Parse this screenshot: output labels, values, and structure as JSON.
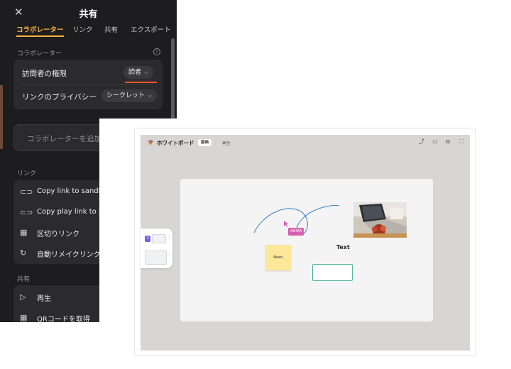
{
  "share_panel": {
    "close_glyph": "✕",
    "title": "共有",
    "tabs": [
      "コラボレーター",
      "リンク",
      "共有",
      "エクスポート"
    ],
    "active_tab": 0,
    "collaborators_heading": "コラボレーター",
    "help_glyph": "?",
    "visitor_permission_label": "訪問者の権限",
    "visitor_permission_value": "読者",
    "link_privacy_label": "リンクのプライバシー",
    "link_privacy_value": "シークレット",
    "add_collaborator_placeholder": "コラボレーターを追加",
    "link_heading": "リンク",
    "link_items": [
      {
        "icon": "link-icon",
        "glyph": "⊂⊃",
        "label": "Copy link to sandbo"
      },
      {
        "icon": "link-icon",
        "glyph": "⊂⊃",
        "label": "Copy play link to sa"
      },
      {
        "icon": "grid-icon",
        "glyph": "▦",
        "label": "区切りリンク"
      },
      {
        "icon": "refresh-icon",
        "glyph": "↻",
        "label": "自動リメイクリンク"
      }
    ],
    "share_heading": "共有",
    "share_items": [
      {
        "icon": "play-icon",
        "glyph": "▷",
        "label": "再生"
      },
      {
        "icon": "qr-icon",
        "glyph": "▦",
        "label": "QRコードを取得"
      }
    ],
    "accent_color": "#ffb23f",
    "underline_color": "#e9582a"
  },
  "whiteboard": {
    "title": "ホワイトボード",
    "badge": "篇画",
    "play_label": "再生",
    "toolbar_icons": [
      "share-icon",
      "crop-icon",
      "open-external-icon",
      "fullscreen-icon"
    ],
    "sticky_note_text": "News",
    "text_label": "Text",
    "cursor_user": "AKIRA",
    "pages": [
      {
        "number": "1",
        "active": true
      },
      {
        "number": "2",
        "active": false
      }
    ],
    "rect_stroke_color": "#4fb79b",
    "note_color": "#fde79a",
    "cursor_color": "#d65fb0"
  }
}
